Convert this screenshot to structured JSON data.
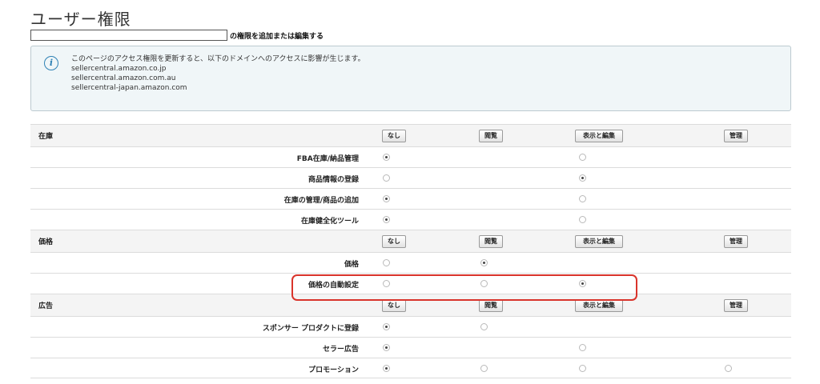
{
  "page": {
    "title": "ユーザー権限",
    "subtitle": "の権限を追加または編集する"
  },
  "info": {
    "message": "このページのアクセス権限を更新すると、以下のドメインへのアクセスに影響が生じます。",
    "domains": [
      "sellercentral.amazon.co.jp",
      "sellercentral.amazon.com.au",
      "sellercentral-japan.amazon.com"
    ]
  },
  "buttons": [
    "なし",
    "閲覧",
    "表示と編集",
    "管理"
  ],
  "sections": [
    {
      "name": "在庫",
      "items": [
        {
          "label": "FBA在庫/納品管理",
          "options": [
            true,
            false,
            true,
            false
          ],
          "selected": 0
        },
        {
          "label": "商品情報の登録",
          "options": [
            true,
            false,
            true,
            false
          ],
          "selected": 2
        },
        {
          "label": "在庫の管理/商品の追加",
          "options": [
            true,
            false,
            true,
            false
          ],
          "selected": 0
        },
        {
          "label": "在庫健全化ツール",
          "options": [
            true,
            false,
            true,
            false
          ],
          "selected": 0
        }
      ]
    },
    {
      "name": "価格",
      "items": [
        {
          "label": "価格",
          "options": [
            true,
            true,
            false,
            false
          ],
          "selected": 1
        },
        {
          "label": "価格の自動設定",
          "options": [
            true,
            true,
            true,
            false
          ],
          "selected": 2
        }
      ]
    },
    {
      "name": "広告",
      "items": [
        {
          "label": "スポンサー プロダクトに登録",
          "options": [
            true,
            true,
            false,
            false
          ],
          "selected": 0
        },
        {
          "label": "セラー広告",
          "options": [
            true,
            false,
            true,
            false
          ],
          "selected": 0
        },
        {
          "label": "プロモーション",
          "options": [
            true,
            true,
            true,
            true
          ],
          "selected": 0
        }
      ]
    }
  ]
}
